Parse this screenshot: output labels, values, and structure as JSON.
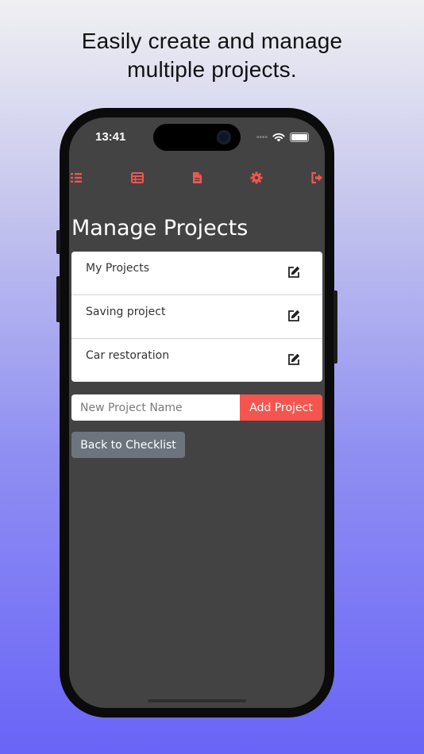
{
  "headline": {
    "line1": "Easily create and manage",
    "line2": "multiple projects."
  },
  "status_bar": {
    "time": "13:41",
    "signal_dots": "••••"
  },
  "navbar": {
    "items": [
      {
        "icon": "list-icon"
      },
      {
        "icon": "table-icon"
      },
      {
        "icon": "document-icon"
      },
      {
        "icon": "gear-icon"
      },
      {
        "icon": "sign-out-icon"
      }
    ],
    "accent_color": "#f4554f"
  },
  "page": {
    "title": "Manage Projects",
    "projects": [
      {
        "name": "My Projects"
      },
      {
        "name": "Saving project"
      },
      {
        "name": "Car restoration"
      }
    ],
    "new_project": {
      "placeholder": "New Project Name",
      "value": ""
    },
    "add_button": "Add Project",
    "back_button": "Back to Checklist"
  },
  "colors": {
    "screen_bg": "#434343",
    "accent": "#f4554f",
    "secondary_button": "#6c757d"
  }
}
